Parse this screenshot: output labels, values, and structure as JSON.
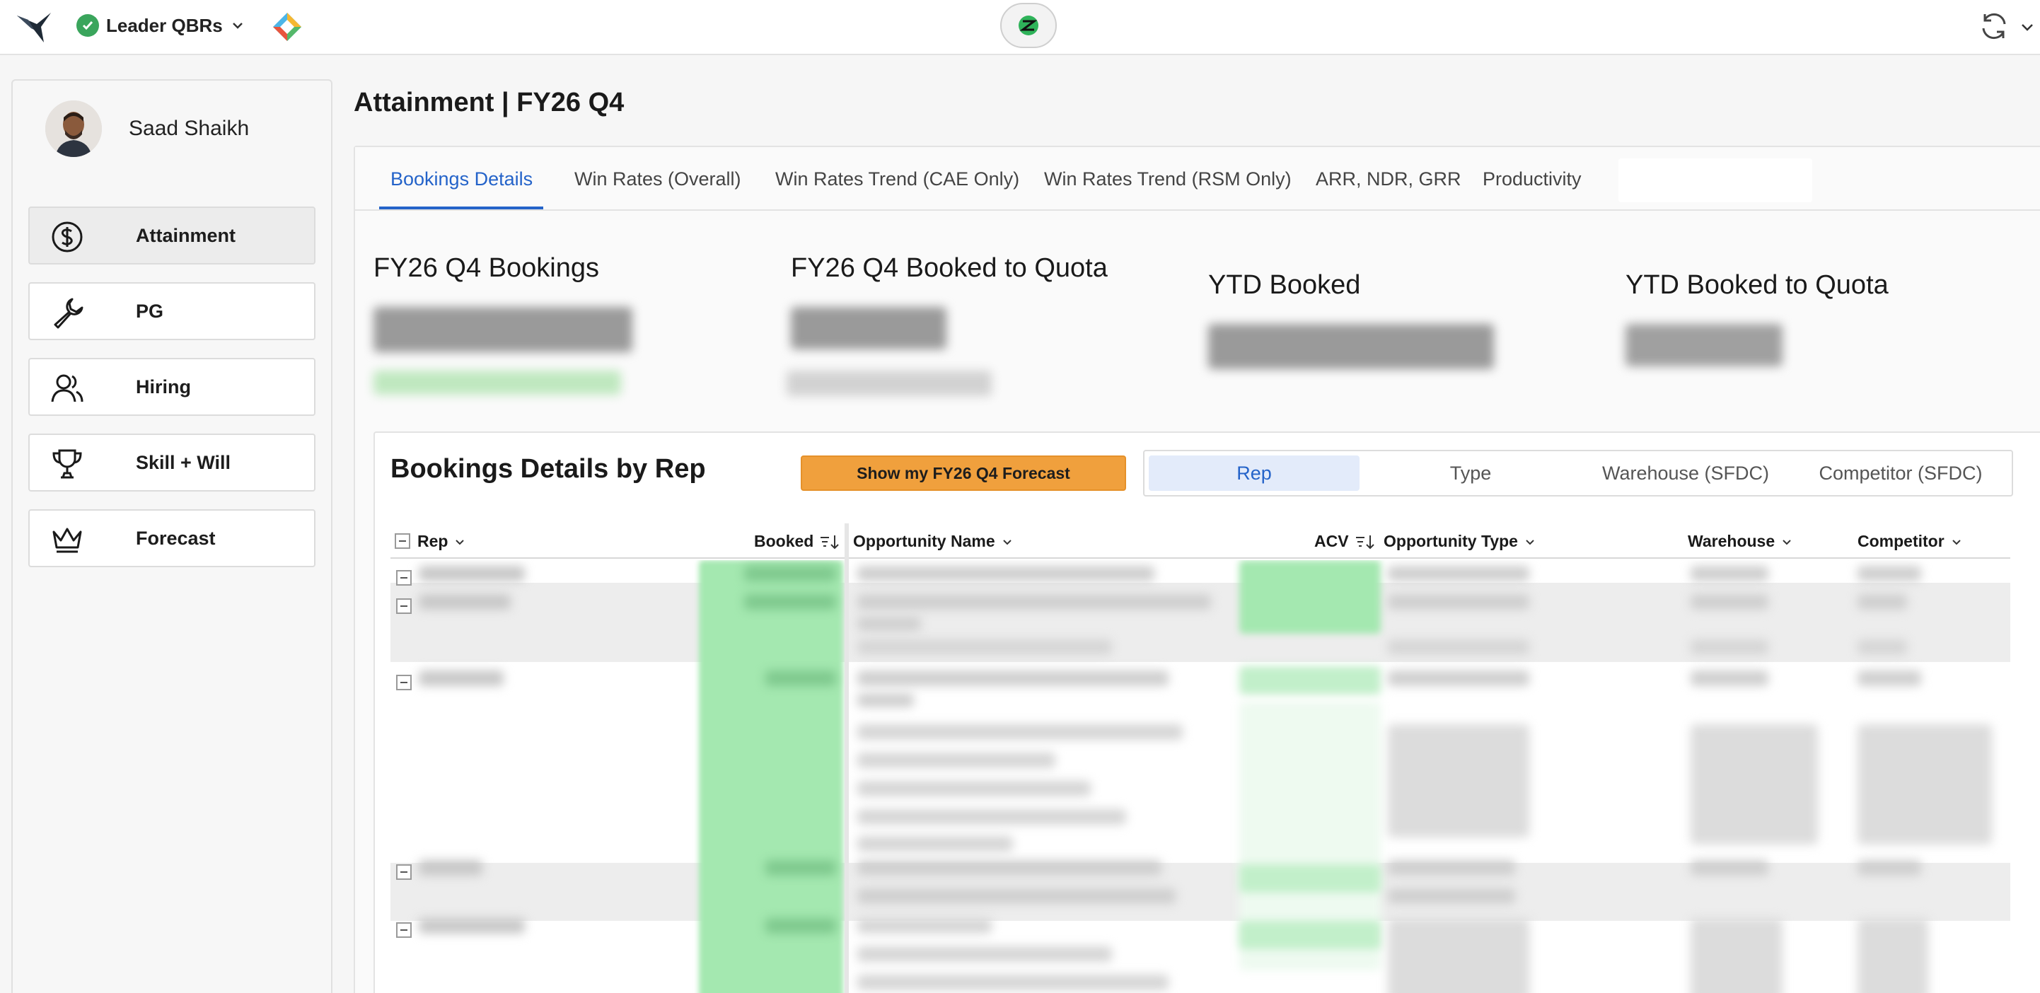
{
  "app": {
    "title": "Leader QBRs",
    "icons": {
      "logo": "bird-logo-icon",
      "status": "check-circle-icon",
      "dropdown": "chevron-down-icon",
      "diamond": "colorful-diamond-icon",
      "center": "sync-badge-icon",
      "refresh": "refresh-icon"
    }
  },
  "sidebar": {
    "user_name": "Saad Shaikh",
    "items": [
      {
        "label": "Attainment",
        "icon": "dollar-circle-icon",
        "active": true
      },
      {
        "label": "PG",
        "icon": "wrench-icon",
        "active": false
      },
      {
        "label": "Hiring",
        "icon": "people-icon",
        "active": false
      },
      {
        "label": "Skill + Will",
        "icon": "trophy-icon",
        "active": false
      },
      {
        "label": "Forecast",
        "icon": "crown-icon",
        "active": false
      }
    ]
  },
  "main": {
    "page_title": "Attainment | FY26 Q4",
    "tabs": [
      {
        "label": "Bookings Details",
        "active": true
      },
      {
        "label": "Win Rates (Overall)"
      },
      {
        "label": "Win Rates Trend (CAE Only)"
      },
      {
        "label": "Win Rates Trend (RSM Only)"
      },
      {
        "label": "ARR, NDR, GRR"
      },
      {
        "label": "Productivity"
      }
    ],
    "kpis": [
      {
        "label": "FY26 Q4 Bookings"
      },
      {
        "label": "FY26 Q4 Booked to Quota"
      },
      {
        "label": "YTD Booked"
      },
      {
        "label": "YTD Booked to Quota"
      }
    ],
    "card": {
      "title": "Bookings Details by Rep",
      "forecast_button": "Show my FY26 Q4 Forecast",
      "segments": [
        {
          "label": "Rep",
          "active": true
        },
        {
          "label": "Type"
        },
        {
          "label": "Warehouse (SFDC)"
        },
        {
          "label": "Competitor (SFDC)"
        }
      ],
      "columns": [
        {
          "label": "Rep"
        },
        {
          "label": "Booked"
        },
        {
          "label": "Opportunity Name"
        },
        {
          "label": "ACV"
        },
        {
          "label": "Opportunity Type"
        },
        {
          "label": "Warehouse"
        },
        {
          "label": "Competitor"
        }
      ]
    }
  }
}
